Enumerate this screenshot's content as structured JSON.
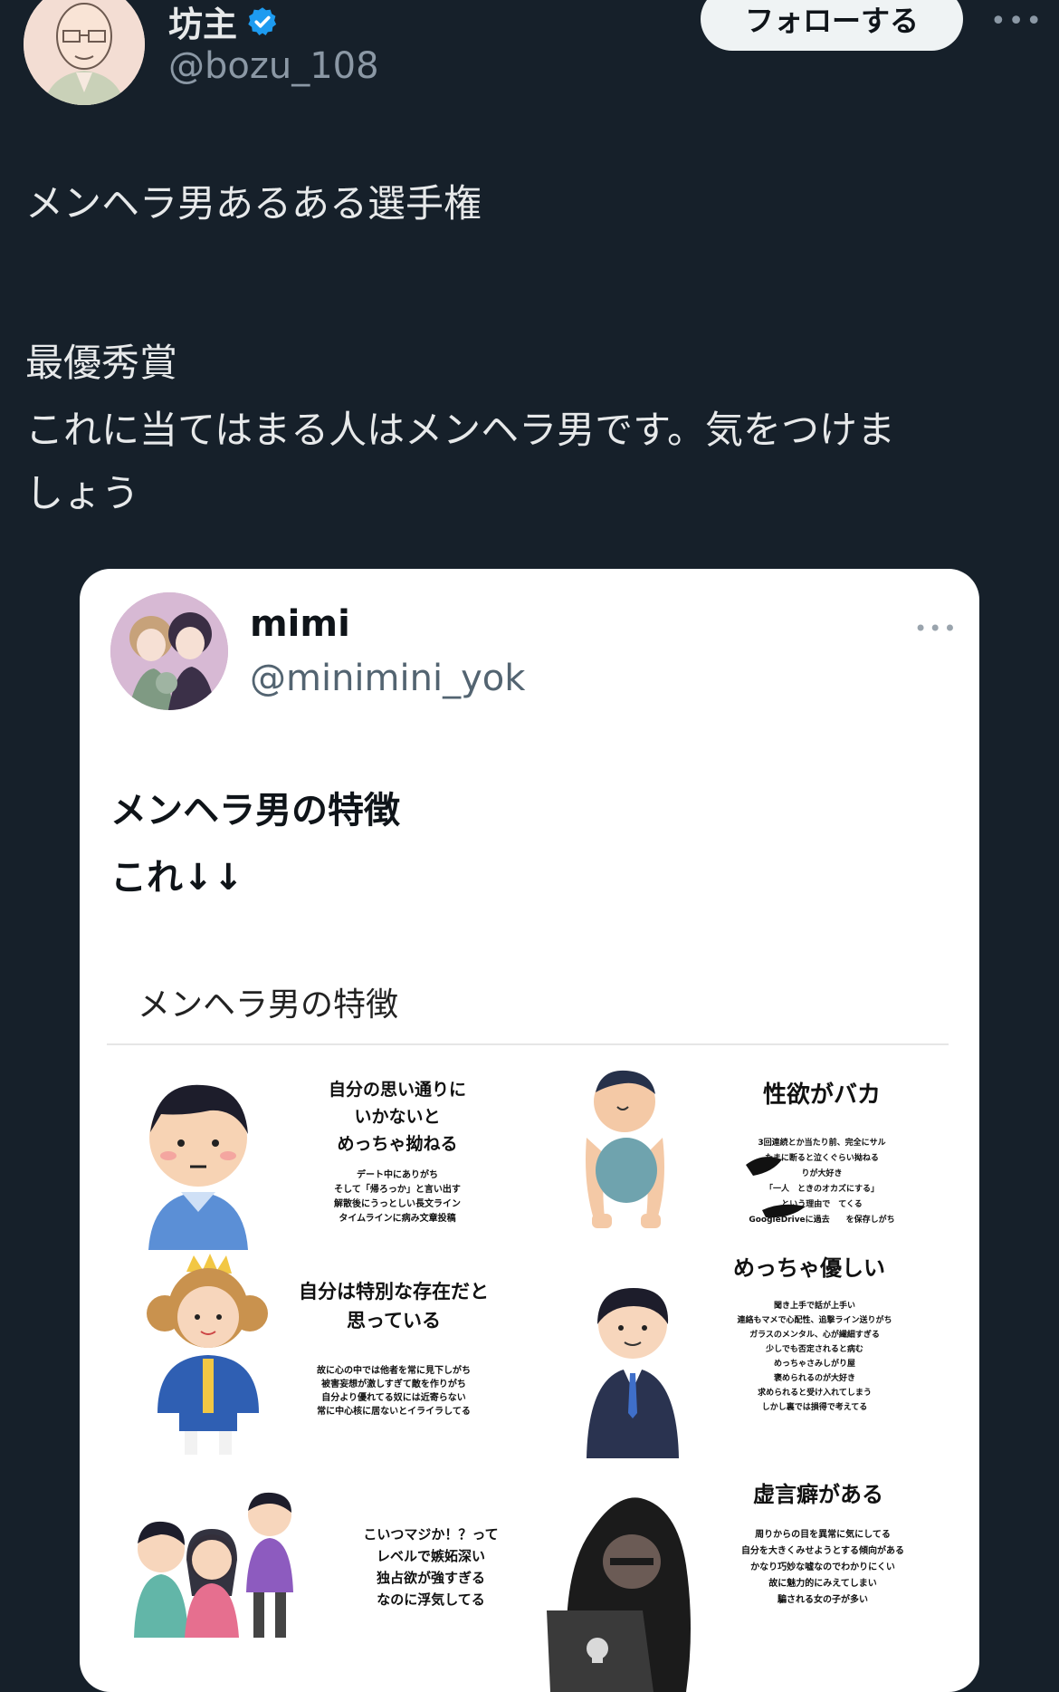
{
  "user": {
    "display_name": "坊主",
    "handle": "@bozu_108",
    "follow_label": "フォローする",
    "more_icon": "•••"
  },
  "tweet": {
    "lines": [
      "メンヘラ男あるある選手権",
      "",
      "最優秀賞",
      "これに当てはまる人はメンヘラ男です。気をつけま",
      "しょう"
    ]
  },
  "quote": {
    "display_name": "mimi",
    "handle": "@minimini_yok",
    "more_icon": "•••",
    "text_lines": [
      "メンヘラ男の特徴",
      "これ↓↓"
    ],
    "image": {
      "title": "メンヘラ男の特徴",
      "panels": [
        {
          "heading_lines": [
            "自分の思い通りに",
            "いかないと",
            "めっちゃ拗ねる"
          ],
          "body_lines": [
            "デート中にありがち",
            "そして「帰ろっか」と言い出す",
            "解散後にうっとしい長文ライン",
            "タイムラインに病み文章投稿"
          ]
        },
        {
          "heading_lines": [
            "性欲がバカ"
          ],
          "body_lines": [
            "3回連続とか当たり前、完全にサル",
            "たまに断ると泣くぐらい拗ねる",
            "りが大好き",
            "「一人　ときのオカズにする」",
            "という理由で　てくる",
            "GoogleDriveに過去　　を保存しがち"
          ]
        },
        {
          "heading_lines": [
            "自分は特別な存在だと",
            "思っている"
          ],
          "body_lines": [
            "故に心の中では他者を常に見下しがち",
            "被害妄想が激しすぎて敵を作りがち",
            "自分より優れてる奴には近寄らない",
            "常に中心核に居ないとイライラしてる"
          ]
        },
        {
          "heading_lines": [
            "めっちゃ優しい"
          ],
          "body_lines": [
            "聞き上手で話が上手い",
            "連絡もマメで心配性、追撃ライン送りがち",
            "ガラスのメンタル、心が繊細すぎる",
            "少しでも否定されると病む",
            "めっちゃさみしがり屋",
            "褒められるのが大好き",
            "求められると受け入れてしまう",
            "しかし裏では損得で考えてる"
          ]
        },
        {
          "heading_lines": [
            "こいつマジか！？って",
            "レベルで嫉妬深い",
            "独占欲が強すぎる",
            "なのに浮気してる"
          ],
          "body_lines": []
        },
        {
          "heading_lines": [
            "虚言癖がある"
          ],
          "body_lines": [
            "周りからの目を異常に気にしてる",
            "自分を大きくみせようとする傾向がある",
            "かなり巧妙な嘘なのでわかりにくい",
            "故に魅力的にみえてしまい",
            "騙される女の子が多い"
          ]
        }
      ]
    }
  },
  "colors": {
    "background": "#16202a",
    "text": "#e7e9ea",
    "secondary": "#8b98a5",
    "verified": "#1d9bf0",
    "card": "#ffffff"
  }
}
